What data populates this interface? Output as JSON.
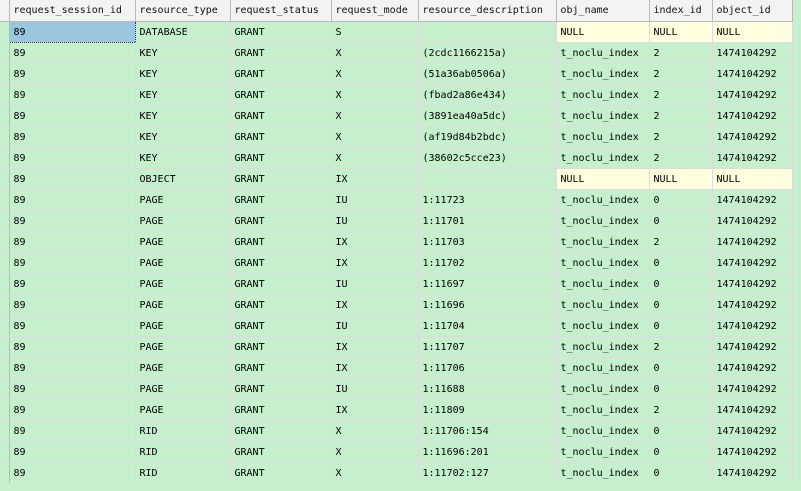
{
  "columns": [
    "request_session_id",
    "resource_type",
    "request_status",
    "request_mode",
    "resource_description",
    "obj_name",
    "index_id",
    "object_id"
  ],
  "rows": [
    [
      "89",
      "DATABASE",
      "GRANT",
      "S",
      "",
      "NULL",
      "NULL",
      "NULL"
    ],
    [
      "89",
      "KEY",
      "GRANT",
      "X",
      "(2cdc1166215a)",
      "t_noclu_index",
      "2",
      "1474104292"
    ],
    [
      "89",
      "KEY",
      "GRANT",
      "X",
      "(51a36ab0506a)",
      "t_noclu_index",
      "2",
      "1474104292"
    ],
    [
      "89",
      "KEY",
      "GRANT",
      "X",
      "(fbad2a86e434)",
      "t_noclu_index",
      "2",
      "1474104292"
    ],
    [
      "89",
      "KEY",
      "GRANT",
      "X",
      "(3891ea40a5dc)",
      "t_noclu_index",
      "2",
      "1474104292"
    ],
    [
      "89",
      "KEY",
      "GRANT",
      "X",
      "(af19d84b2bdc)",
      "t_noclu_index",
      "2",
      "1474104292"
    ],
    [
      "89",
      "KEY",
      "GRANT",
      "X",
      "(38602c5cce23)",
      "t_noclu_index",
      "2",
      "1474104292"
    ],
    [
      "89",
      "OBJECT",
      "GRANT",
      "IX",
      "",
      "NULL",
      "NULL",
      "NULL"
    ],
    [
      "89",
      "PAGE",
      "GRANT",
      "IU",
      "1:11723",
      "t_noclu_index",
      "0",
      "1474104292"
    ],
    [
      "89",
      "PAGE",
      "GRANT",
      "IU",
      "1:11701",
      "t_noclu_index",
      "0",
      "1474104292"
    ],
    [
      "89",
      "PAGE",
      "GRANT",
      "IX",
      "1:11703",
      "t_noclu_index",
      "2",
      "1474104292"
    ],
    [
      "89",
      "PAGE",
      "GRANT",
      "IX",
      "1:11702",
      "t_noclu_index",
      "0",
      "1474104292"
    ],
    [
      "89",
      "PAGE",
      "GRANT",
      "IU",
      "1:11697",
      "t_noclu_index",
      "0",
      "1474104292"
    ],
    [
      "89",
      "PAGE",
      "GRANT",
      "IX",
      "1:11696",
      "t_noclu_index",
      "0",
      "1474104292"
    ],
    [
      "89",
      "PAGE",
      "GRANT",
      "IU",
      "1:11704",
      "t_noclu_index",
      "0",
      "1474104292"
    ],
    [
      "89",
      "PAGE",
      "GRANT",
      "IX",
      "1:11707",
      "t_noclu_index",
      "2",
      "1474104292"
    ],
    [
      "89",
      "PAGE",
      "GRANT",
      "IX",
      "1:11706",
      "t_noclu_index",
      "0",
      "1474104292"
    ],
    [
      "89",
      "PAGE",
      "GRANT",
      "IU",
      "1:11688",
      "t_noclu_index",
      "0",
      "1474104292"
    ],
    [
      "89",
      "PAGE",
      "GRANT",
      "IX",
      "1:11809",
      "t_noclu_index",
      "2",
      "1474104292"
    ],
    [
      "89",
      "RID",
      "GRANT",
      "X",
      "1:11706:154",
      "t_noclu_index",
      "0",
      "1474104292"
    ],
    [
      "89",
      "RID",
      "GRANT",
      "X",
      "1:11696:201",
      "t_noclu_index",
      "0",
      "1474104292"
    ],
    [
      "89",
      "RID",
      "GRANT",
      "X",
      "1:11702:127",
      "t_noclu_index",
      "0",
      "1474104292"
    ]
  ],
  "colors": {
    "grid_background": "#c6efce",
    "null_cell_background": "#ffffe0",
    "selected_cell_background": "#9ac6e0",
    "header_background": "#f3f3f3"
  },
  "selection": {
    "row": 0,
    "column": 0
  }
}
